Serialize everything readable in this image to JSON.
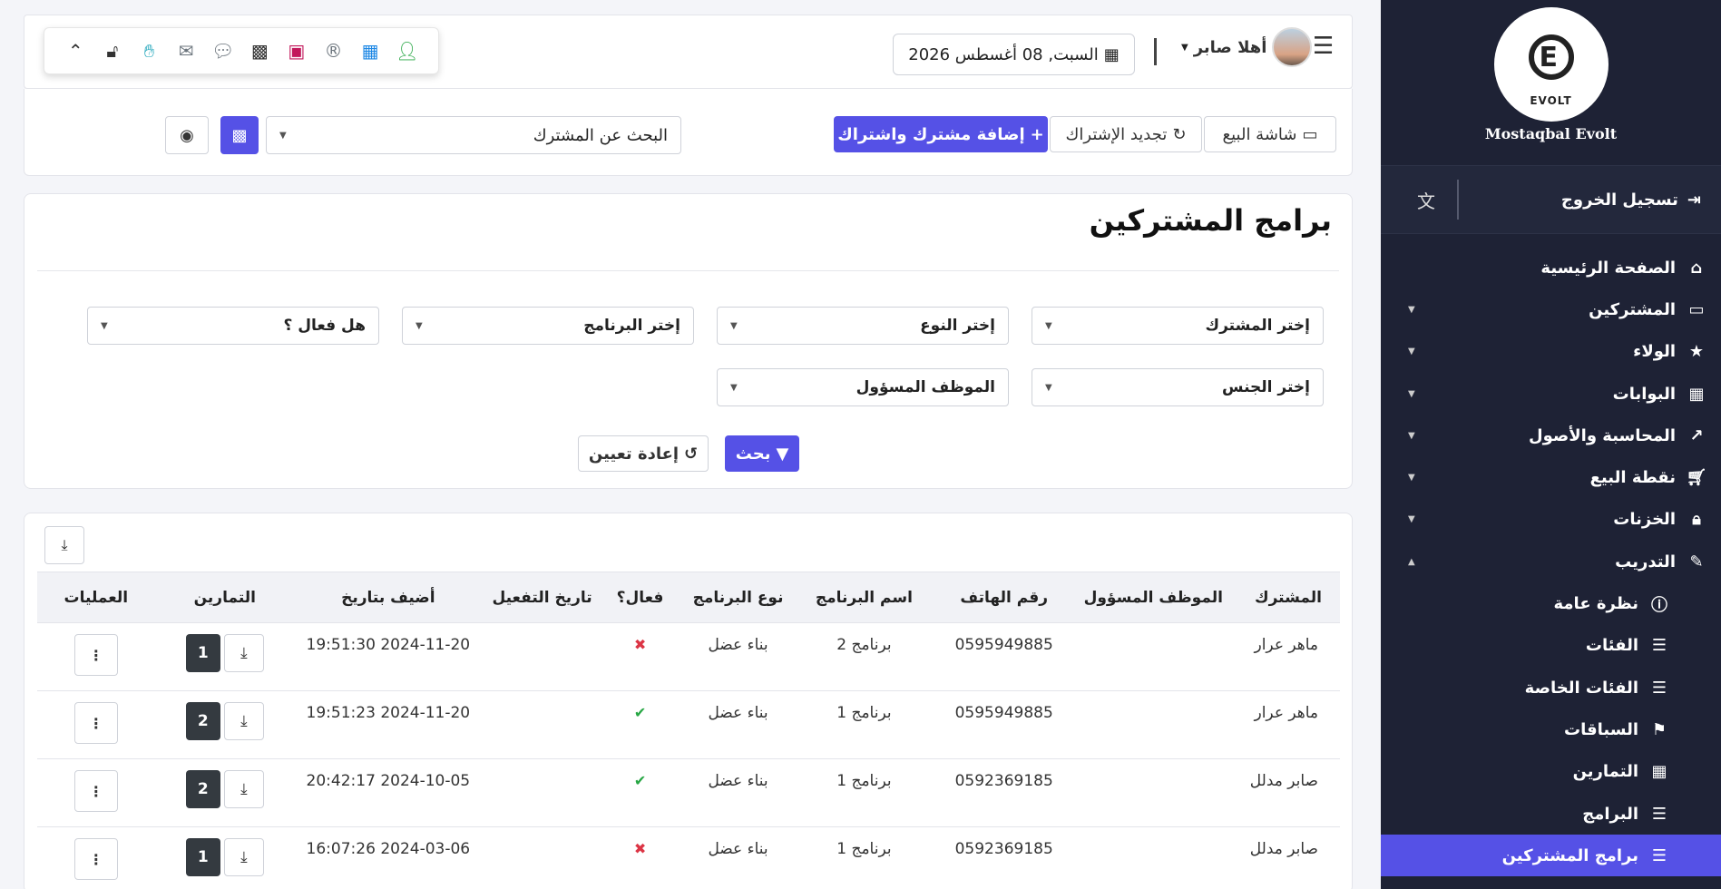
{
  "sidebar": {
    "logo_text": "EVOLT",
    "brand_name": "Mostaqbal Evolt",
    "logout_label": "تسجيل الخروج",
    "items": [
      {
        "label": "الصفحة الرئيسية"
      },
      {
        "label": "المشتركين"
      },
      {
        "label": "الولاء"
      },
      {
        "label": "البوابات"
      },
      {
        "label": "المحاسبة والأصول"
      },
      {
        "label": "نقطة البيع"
      },
      {
        "label": "الخزنات"
      },
      {
        "label": "التدريب"
      },
      {
        "label": "نظرة عامة"
      },
      {
        "label": "الفئات"
      },
      {
        "label": "الفئات الخاصة"
      },
      {
        "label": "السباقات"
      },
      {
        "label": "التمارين"
      },
      {
        "label": "البرامج"
      },
      {
        "label": "برامج المشتركين"
      }
    ]
  },
  "header": {
    "date": "السبت, 08 أغسطس 2026",
    "greeting": "أهلا صابر"
  },
  "actions": {
    "pos_label": "شاشة البيع",
    "renew_label": "تجديد الإشتراك",
    "add_label": "إضافة مشترك واشتراك",
    "search_placeholder": "البحث عن المشترك"
  },
  "filter": {
    "title": "برامج المشتركين",
    "subscriber": "إختر المشترك",
    "type": "إختر النوع",
    "program": "إختر البرنامج",
    "is_active": "هل فعال ؟",
    "gender": "إختر الجنس",
    "employee": "الموظف المسؤول",
    "search_label": "بحث",
    "reset_label": "إعادة تعيين"
  },
  "table": {
    "headers": {
      "subscriber": "المشترك",
      "employee": "الموظف المسؤول",
      "phone": "رقم الهاتف",
      "program_name": "اسم البرنامج",
      "program_type": "نوع البرنامج",
      "active": "فعال؟",
      "activation_date": "تاريخ التفعيل",
      "added_date": "أضيف بتاريخ",
      "exercises": "التمارين",
      "operations": "العمليات"
    },
    "rows": [
      {
        "subscriber": "ماهر عرار",
        "employee": "",
        "phone": "0595949885",
        "program_name": "برنامج 2",
        "program_type": "بناء عضل",
        "active": "✖",
        "activation_date": "",
        "added_date": "2024-11-20 19:51:30",
        "exercises": "1"
      },
      {
        "subscriber": "ماهر عرار",
        "employee": "",
        "phone": "0595949885",
        "program_name": "برنامج 1",
        "program_type": "بناء عضل",
        "active": "✔",
        "activation_date": "",
        "added_date": "2024-11-20 19:51:23",
        "exercises": "2"
      },
      {
        "subscriber": "صابر مدلل",
        "employee": "",
        "phone": "0592369185",
        "program_name": "برنامج 1",
        "program_type": "بناء عضل",
        "active": "✔",
        "activation_date": "",
        "added_date": "2024-10-05 20:42:17",
        "exercises": "2"
      },
      {
        "subscriber": "صابر مدلل",
        "employee": "",
        "phone": "0592369185",
        "program_name": "برنامج 1",
        "program_type": "بناء عضل",
        "active": "✖",
        "activation_date": "",
        "added_date": "2024-03-06 16:07:26",
        "exercises": "1"
      }
    ]
  },
  "colors": {
    "primary": "#5551e6",
    "sidebar": "#1e2235",
    "active_ok": "#28a745",
    "active_no": "#dc3545"
  }
}
